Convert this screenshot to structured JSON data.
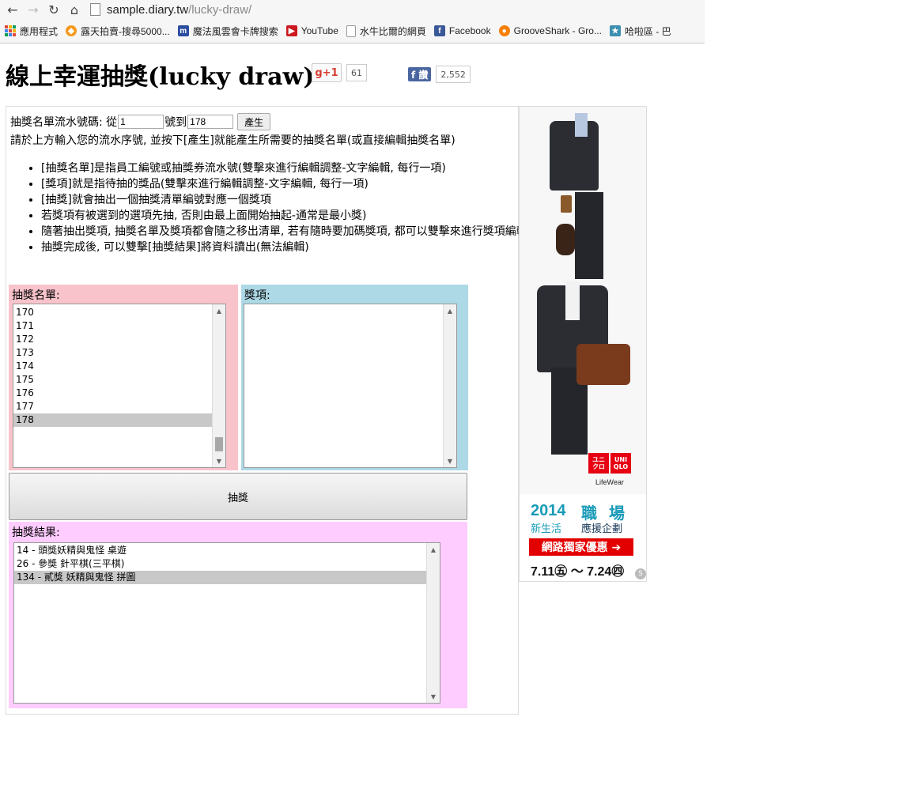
{
  "browser": {
    "url_host": "sample.diary.tw",
    "url_path": "/lucky-draw/",
    "bookmarks": [
      {
        "label": "應用程式",
        "icon": "apps-grid-icon"
      },
      {
        "label": "露天拍賣-搜尋5000...",
        "icon": "ruten-icon"
      },
      {
        "label": "魔法風雲會卡牌搜索",
        "icon": "m-site-icon"
      },
      {
        "label": "YouTube",
        "icon": "youtube-icon"
      },
      {
        "label": "水牛比爾的網頁",
        "icon": "page-icon"
      },
      {
        "label": "Facebook",
        "icon": "facebook-icon"
      },
      {
        "label": "GrooveShark - Gro...",
        "icon": "grooveshark-icon"
      },
      {
        "label": "哈啦區 - 巴",
        "icon": "bahamut-icon"
      }
    ]
  },
  "header": {
    "title": "線上幸運抽獎(lucky draw)",
    "gplus_label": "g+1",
    "gplus_count": "61",
    "fb_label": "f 讚",
    "fb_count": "2,552"
  },
  "form": {
    "range_label_from": "抽獎名單流水號碼: 從",
    "from_value": "1",
    "range_label_to": "號到",
    "to_value": "178",
    "generate_label": "產生",
    "hint": "請於上方輸入您的流水序號, 並按下[產生]就能產生所需要的抽獎名單(或直接編輯抽獎名單)"
  },
  "notes": [
    "[抽獎名單]是指員工編號或抽獎券流水號(雙擊來進行編輯調整-文字編輯, 每行一項)",
    "[獎項]就是指待抽的獎品(雙擊來進行編輯調整-文字編輯, 每行一項)",
    "[抽獎]就會抽出一個抽獎清單編號對應一個獎項",
    "若獎項有被選到的選項先抽, 否則由最上面開始抽起-通常是最小獎)",
    "隨著抽出獎項, 抽獎名單及獎項都會隨之移出清單, 若有隨時要加碼獎項, 都可以雙擊來進行獎項編輯",
    "抽獎完成後, 可以雙擊[抽獎結果]將資料讀出(無法編輯)"
  ],
  "names": {
    "label": "抽獎名單:",
    "items": [
      "170",
      "171",
      "172",
      "173",
      "174",
      "175",
      "176",
      "177",
      "178"
    ],
    "selected_index": 8
  },
  "prizes": {
    "label": "獎項:"
  },
  "draw_button": "抽獎",
  "results": {
    "label": "抽獎結果:",
    "items": [
      "14 - 頭獎妖精與鬼怪 桌遊",
      "26 - 參獎 針平棋(三平棋)",
      "134 - 貳獎 妖精與鬼怪 拼圖"
    ],
    "selected_index": 2
  },
  "ad": {
    "brand": "UNI QLO",
    "brand_left": "ユニ クロ",
    "lifewear": "LifeWear",
    "year": "2014",
    "subtitle": "新生活",
    "job": "職 場",
    "cheer": "應援企劃",
    "offer": "網路獨家優惠 ➔",
    "dates": "7.11㊄ 〜 7.24㊃",
    "corner": "S"
  },
  "colors": {
    "names_bg": "#f8c3cb",
    "prizes_bg": "#add8e6",
    "results_bg": "#ffccff",
    "uniqlo_red": "#e60012"
  }
}
